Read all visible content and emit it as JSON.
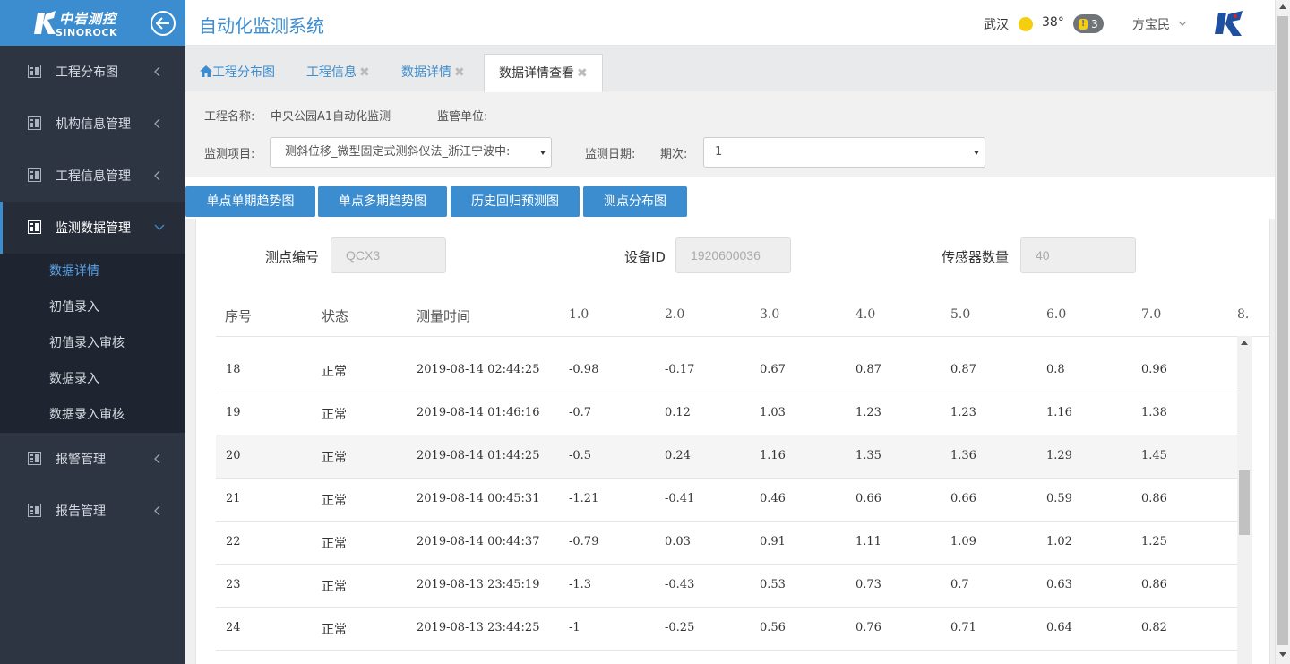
{
  "sidebar": {
    "logo_cn": "中岩测控",
    "logo_en": "SINOROCK",
    "menu": [
      {
        "label": "工程分布图"
      },
      {
        "label": "机构信息管理"
      },
      {
        "label": "工程信息管理"
      },
      {
        "label": "监测数据管理"
      },
      {
        "label": "报警管理"
      },
      {
        "label": "报告管理"
      }
    ],
    "submenu": [
      {
        "label": "数据详情"
      },
      {
        "label": "初值录入"
      },
      {
        "label": "初值录入审核"
      },
      {
        "label": "数据录入"
      },
      {
        "label": "数据录入审核"
      }
    ]
  },
  "header": {
    "title": "自动化监测系统",
    "city": "武汉",
    "temperature": "38°",
    "alert_count": "3",
    "user": "方宝民"
  },
  "tabs": [
    {
      "label": "工程分布图"
    },
    {
      "label": "工程信息"
    },
    {
      "label": "数据详情"
    },
    {
      "label": "数据详情查看"
    }
  ],
  "filters": {
    "project_label": "工程名称:",
    "project_value": "中央公园A1自动化监测",
    "supervisor_label": "监管单位:",
    "item_label": "监测项目:",
    "item_value": "测斜位移_微型固定式测斜仪法_浙江宁波中:",
    "date_label": "监测日期:",
    "period_label": "期次:",
    "period_value": "1"
  },
  "buttons": [
    {
      "label": "单点单期趋势图"
    },
    {
      "label": "单点多期趋势图"
    },
    {
      "label": "历史回归预测图"
    },
    {
      "label": "测点分布图"
    }
  ],
  "info": {
    "point_label": "测点编号",
    "point_value": "QCX3",
    "device_label": "设备ID",
    "device_value": "1920600036",
    "sensor_label": "传感器数量",
    "sensor_value": "40"
  },
  "table": {
    "headers": [
      "序号",
      "状态",
      "测量时间",
      "1.0",
      "2.0",
      "3.0",
      "4.0",
      "5.0",
      "6.0",
      "7.0",
      "8."
    ],
    "rows": [
      [
        "18",
        "正常",
        "2019-08-14 02:44:25",
        "-0.98",
        "-0.17",
        "0.67",
        "0.87",
        "0.87",
        "0.8",
        "0.96"
      ],
      [
        "19",
        "正常",
        "2019-08-14 01:46:16",
        "-0.7",
        "0.12",
        "1.03",
        "1.23",
        "1.23",
        "1.16",
        "1.38"
      ],
      [
        "20",
        "正常",
        "2019-08-14 01:44:25",
        "-0.5",
        "0.24",
        "1.16",
        "1.35",
        "1.36",
        "1.29",
        "1.45"
      ],
      [
        "21",
        "正常",
        "2019-08-14 00:45:31",
        "-1.21",
        "-0.41",
        "0.46",
        "0.66",
        "0.66",
        "0.59",
        "0.86"
      ],
      [
        "22",
        "正常",
        "2019-08-14 00:44:37",
        "-0.79",
        "0.03",
        "0.91",
        "1.11",
        "1.09",
        "1.02",
        "1.25"
      ],
      [
        "23",
        "正常",
        "2019-08-13 23:45:19",
        "-1.3",
        "-0.43",
        "0.53",
        "0.73",
        "0.7",
        "0.63",
        "0.86"
      ],
      [
        "24",
        "正常",
        "2019-08-13 23:44:25",
        "-1",
        "-0.25",
        "0.56",
        "0.76",
        "0.71",
        "0.64",
        "0.82"
      ]
    ]
  },
  "colors": {
    "primary": "#3c8dcf",
    "sidebar_bg": "#2d3442",
    "submenu_active": "#5ba3e8"
  }
}
